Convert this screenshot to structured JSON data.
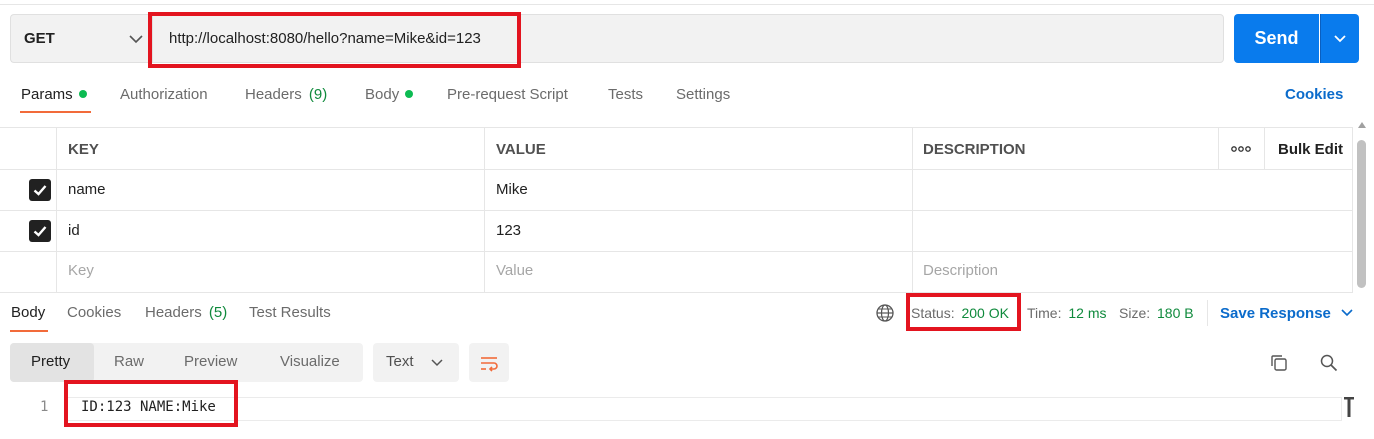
{
  "request": {
    "method": "GET",
    "url": "http://localhost:8080/hello?name=Mike&id=123",
    "send_label": "Send"
  },
  "request_tabs": [
    {
      "label": "Params",
      "dot": true
    },
    {
      "label": "Authorization"
    },
    {
      "label": "Headers",
      "count": "(9)"
    },
    {
      "label": "Body",
      "dot": true
    },
    {
      "label": "Pre-request Script"
    },
    {
      "label": "Tests"
    },
    {
      "label": "Settings"
    }
  ],
  "cookies_link": "Cookies",
  "params_table": {
    "headers": {
      "key": "KEY",
      "value": "VALUE",
      "description": "DESCRIPTION",
      "more": "ooo",
      "bulk_edit": "Bulk Edit"
    },
    "rows": [
      {
        "checked": true,
        "key": "name",
        "value": "Mike",
        "description": ""
      },
      {
        "checked": true,
        "key": "id",
        "value": "123",
        "description": ""
      }
    ],
    "placeholders": {
      "key": "Key",
      "value": "Value",
      "description": "Description"
    }
  },
  "response_tabs": [
    {
      "label": "Body"
    },
    {
      "label": "Cookies"
    },
    {
      "label": "Headers",
      "count": "(5)"
    },
    {
      "label": "Test Results"
    }
  ],
  "response_meta": {
    "status_label": "Status:",
    "status_value": "200 OK",
    "time_label": "Time:",
    "time_value": "12 ms",
    "size_label": "Size:",
    "size_value": "180 B",
    "save_label": "Save Response"
  },
  "body_view": {
    "modes": [
      "Pretty",
      "Raw",
      "Preview",
      "Visualize"
    ],
    "format": "Text"
  },
  "response_body": {
    "line_number": "1",
    "line_text": "ID:123 NAME:Mike"
  },
  "colors": {
    "accent": "#097bed",
    "tab_underline": "#f26b3a",
    "success": "#0f8a3c",
    "annotation": "#e3141f",
    "link": "#0b6bcb"
  }
}
